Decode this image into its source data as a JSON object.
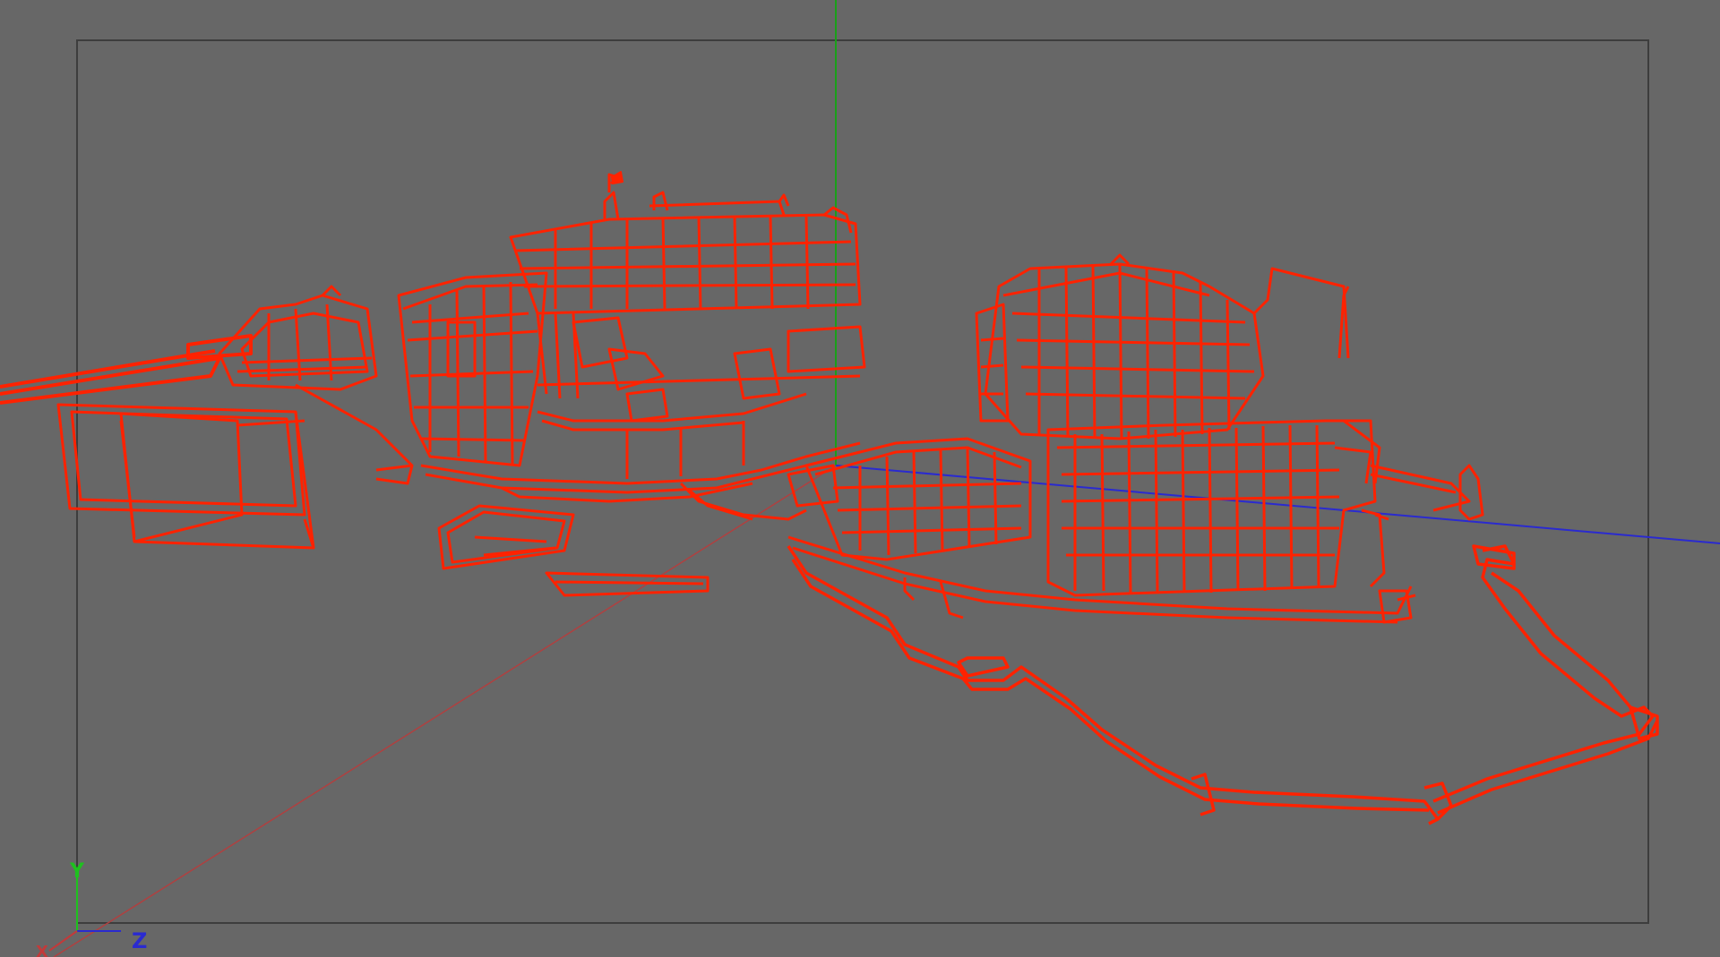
{
  "viewport": {
    "view": "perspective",
    "background_color": "#676767",
    "frame_color": "#3a3a3a",
    "wireframe_color": "#ff2200",
    "axis_colors": {
      "x": "#c23a3a",
      "y": "#1aa01a",
      "z": "#2a2ad0"
    }
  },
  "gizmo": {
    "y_label": "Y",
    "z_label": "Z",
    "x_label": "X"
  }
}
